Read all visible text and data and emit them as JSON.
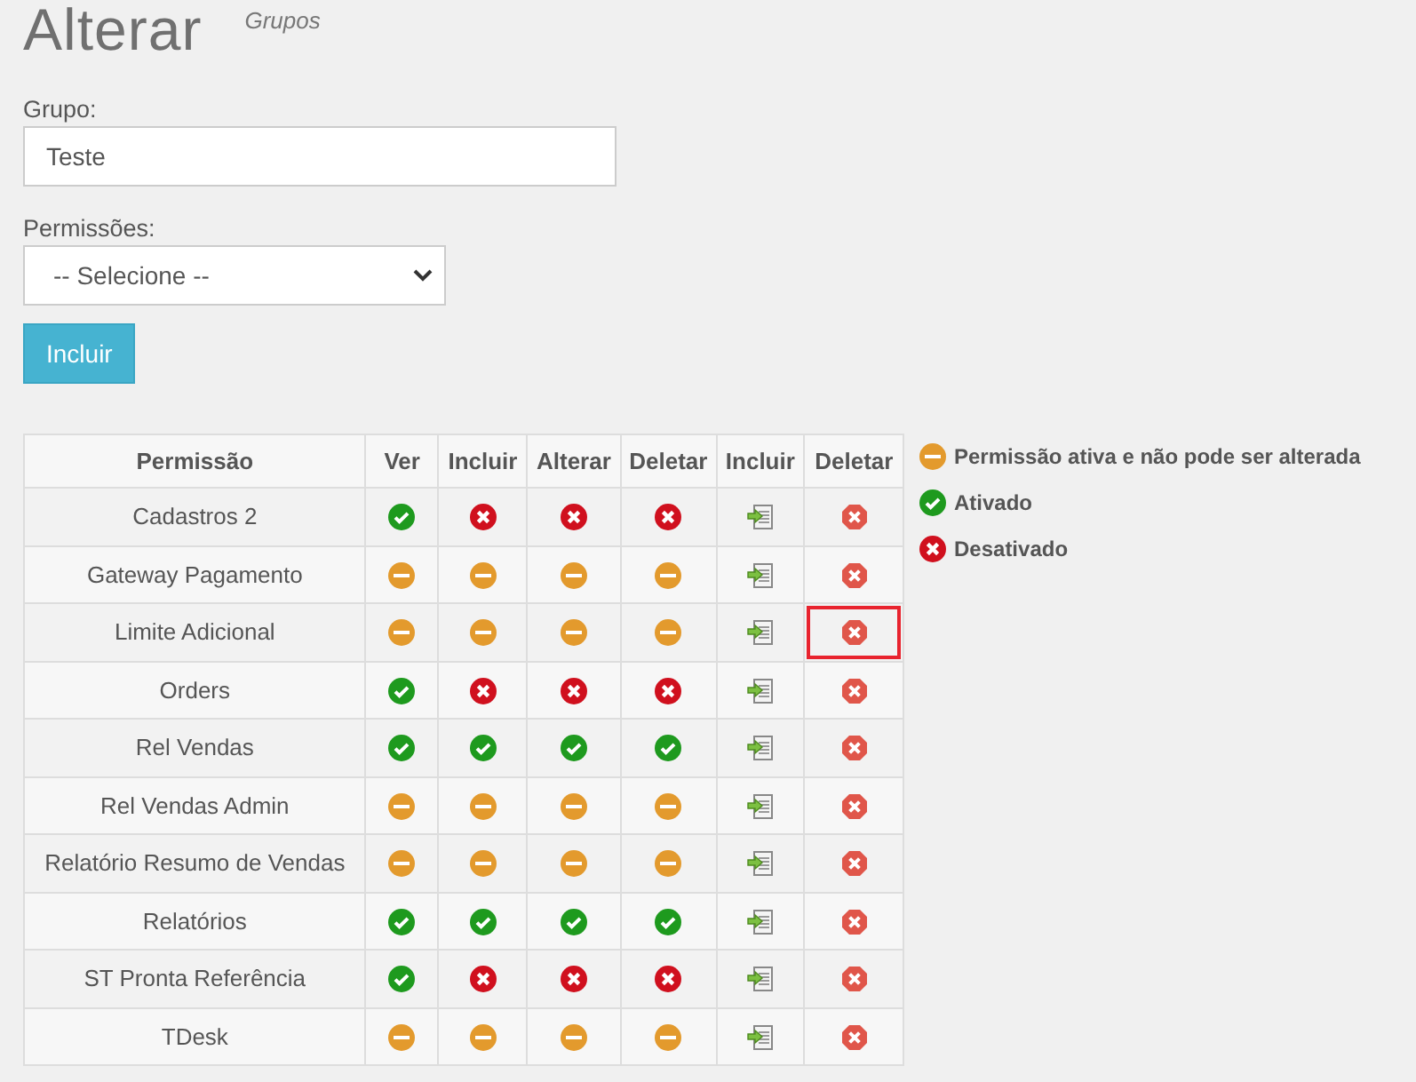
{
  "title": "Alterar",
  "subtitle": "Grupos",
  "group_field": {
    "label": "Grupo:",
    "value": "Teste"
  },
  "permission_select": {
    "label": "Permissões:",
    "value": "-- Selecione --"
  },
  "add_button": "Incluir",
  "table": {
    "columns": [
      "Permissão",
      "Ver",
      "Incluir",
      "Alterar",
      "Deletar",
      "Incluir",
      "Deletar"
    ],
    "rows": [
      {
        "name": "Cadastros 2",
        "states": [
          {
            "kind": "on"
          },
          {
            "kind": "off"
          },
          {
            "kind": "off"
          },
          {
            "kind": "off"
          }
        ],
        "highlighted": false
      },
      {
        "name": "Gateway Pagamento",
        "states": [
          {
            "kind": "locked"
          },
          {
            "kind": "locked"
          },
          {
            "kind": "locked"
          },
          {
            "kind": "locked"
          }
        ],
        "highlighted": false
      },
      {
        "name": "Limite Adicional",
        "states": [
          {
            "kind": "locked"
          },
          {
            "kind": "locked"
          },
          {
            "kind": "locked"
          },
          {
            "kind": "locked"
          }
        ],
        "highlighted": true
      },
      {
        "name": "Orders",
        "states": [
          {
            "kind": "on"
          },
          {
            "kind": "off"
          },
          {
            "kind": "off"
          },
          {
            "kind": "off"
          }
        ],
        "highlighted": false
      },
      {
        "name": "Rel Vendas",
        "states": [
          {
            "kind": "on"
          },
          {
            "kind": "on"
          },
          {
            "kind": "on"
          },
          {
            "kind": "on"
          }
        ],
        "highlighted": false
      },
      {
        "name": "Rel Vendas Admin",
        "states": [
          {
            "kind": "locked"
          },
          {
            "kind": "locked"
          },
          {
            "kind": "locked"
          },
          {
            "kind": "locked"
          }
        ],
        "highlighted": false
      },
      {
        "name": "Relatório Resumo de Vendas",
        "states": [
          {
            "kind": "locked"
          },
          {
            "kind": "locked"
          },
          {
            "kind": "locked"
          },
          {
            "kind": "locked"
          }
        ],
        "highlighted": false
      },
      {
        "name": "Relatórios",
        "states": [
          {
            "kind": "on"
          },
          {
            "kind": "on"
          },
          {
            "kind": "on"
          },
          {
            "kind": "on"
          }
        ],
        "highlighted": false
      },
      {
        "name": "ST Pronta Referência",
        "states": [
          {
            "kind": "on"
          },
          {
            "kind": "off"
          },
          {
            "kind": "off"
          },
          {
            "kind": "off"
          }
        ],
        "highlighted": false
      },
      {
        "name": "TDesk",
        "states": [
          {
            "kind": "locked"
          },
          {
            "kind": "locked"
          },
          {
            "kind": "locked"
          },
          {
            "kind": "locked"
          }
        ],
        "highlighted": false
      }
    ]
  },
  "legend": [
    {
      "kind": "locked",
      "text": "Permissão ativa e não pode ser alterada"
    },
    {
      "kind": "on",
      "text": "Ativado"
    },
    {
      "kind": "off",
      "text": "Desativado"
    }
  ]
}
